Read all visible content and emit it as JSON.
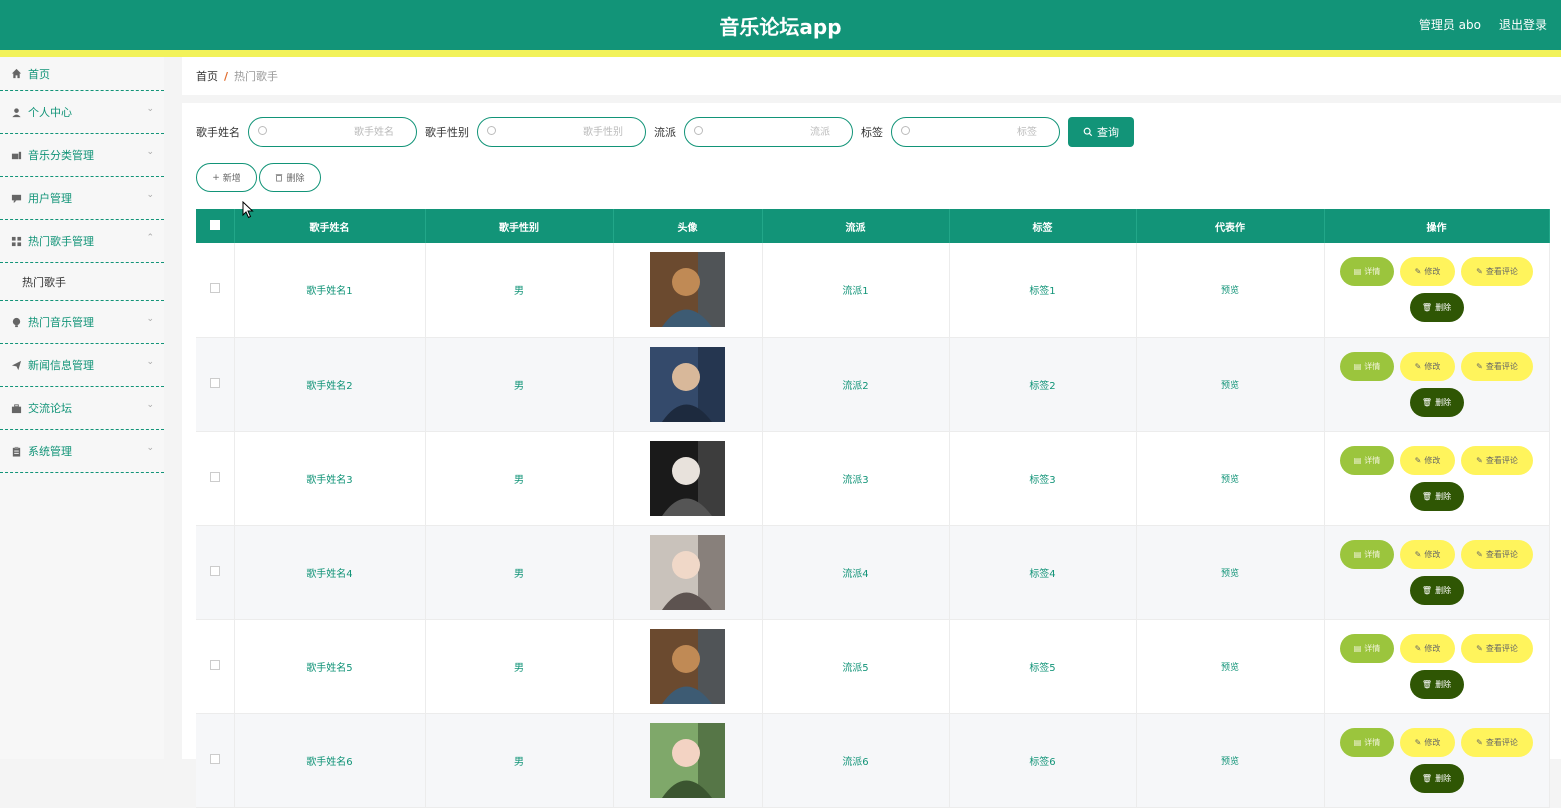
{
  "header": {
    "title": "音乐论坛app",
    "user_label": "管理员 abo",
    "logout_label": "退出登录"
  },
  "sidebar": {
    "items": [
      {
        "label": "首页",
        "icon": "home-icon"
      },
      {
        "label": "个人中心",
        "icon": "user-icon"
      },
      {
        "label": "音乐分类管理",
        "icon": "category-icon"
      },
      {
        "label": "用户管理",
        "icon": "comment-icon"
      },
      {
        "label": "热门歌手管理",
        "icon": "grid-icon"
      },
      {
        "label": "热门音乐管理",
        "icon": "bulb-icon"
      },
      {
        "label": "新闻信息管理",
        "icon": "send-icon"
      },
      {
        "label": "交流论坛",
        "icon": "briefcase-icon"
      },
      {
        "label": "系统管理",
        "icon": "clipboard-icon"
      }
    ],
    "submenu": {
      "label": "热门歌手"
    }
  },
  "breadcrumb": {
    "home": "首页",
    "separator": "/",
    "current": "热门歌手"
  },
  "search": {
    "name_label": "歌手姓名",
    "name_placeholder": "歌手姓名",
    "gender_label": "歌手性别",
    "gender_placeholder": "歌手性别",
    "genre_label": "流派",
    "genre_placeholder": "流派",
    "tag_label": "标签",
    "tag_placeholder": "标签",
    "query_label": "查询"
  },
  "actions": {
    "add_label": "新增",
    "delete_label": "删除"
  },
  "table": {
    "columns": [
      "歌手姓名",
      "歌手性别",
      "头像",
      "流派",
      "标签",
      "代表作",
      "操作"
    ],
    "rows": [
      {
        "name": "歌手姓名1",
        "gender": "男",
        "genre": "流派1",
        "tag": "标签1",
        "work": "预览"
      },
      {
        "name": "歌手姓名2",
        "gender": "男",
        "genre": "流派2",
        "tag": "标签2",
        "work": "预览"
      },
      {
        "name": "歌手姓名3",
        "gender": "男",
        "genre": "流派3",
        "tag": "标签3",
        "work": "预览"
      },
      {
        "name": "歌手姓名4",
        "gender": "男",
        "genre": "流派4",
        "tag": "标签4",
        "work": "预览"
      },
      {
        "name": "歌手姓名5",
        "gender": "男",
        "genre": "流派5",
        "tag": "标签5",
        "work": "预览"
      },
      {
        "name": "歌手姓名6",
        "gender": "男",
        "genre": "流派6",
        "tag": "标签6",
        "work": "预览"
      }
    ],
    "op_labels": {
      "detail": "详情",
      "edit": "修改",
      "comment": "查看评论",
      "delete": "删除"
    }
  },
  "colors": {
    "primary": "#129478",
    "accent_stripe": "#f2f25a",
    "detail_button": "#9bc53d",
    "edit_button": "#fff45c",
    "delete_button": "#2f5604"
  }
}
